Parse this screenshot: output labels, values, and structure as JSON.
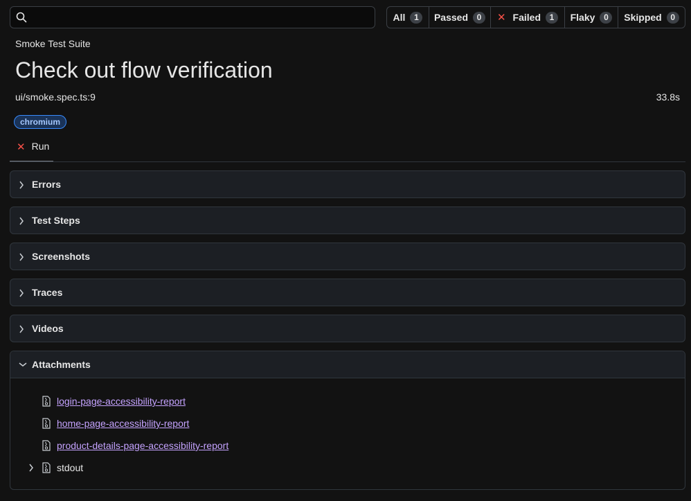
{
  "search": {
    "value": "",
    "placeholder": ""
  },
  "filters": [
    {
      "label": "All",
      "count": "1"
    },
    {
      "label": "Passed",
      "count": "0"
    },
    {
      "label": "Failed",
      "count": "1"
    },
    {
      "label": "Flaky",
      "count": "0"
    },
    {
      "label": "Skipped",
      "count": "0"
    }
  ],
  "test": {
    "suite": "Smoke Test Suite",
    "title": "Check out flow verification",
    "location": "ui/smoke.spec.ts:9",
    "duration": "33.8s",
    "tag": "chromium"
  },
  "run_tab": {
    "label": "Run",
    "status_icon": "x-icon"
  },
  "sections": [
    {
      "label": "Errors",
      "expanded": false
    },
    {
      "label": "Test Steps",
      "expanded": false
    },
    {
      "label": "Screenshots",
      "expanded": false
    },
    {
      "label": "Traces",
      "expanded": false
    },
    {
      "label": "Videos",
      "expanded": false
    }
  ],
  "attachments": {
    "label": "Attachments",
    "expanded": true,
    "items": [
      {
        "name": "login-page-accessibility-report",
        "link": true
      },
      {
        "name": "home-page-accessibility-report",
        "link": true
      },
      {
        "name": "product-details-page-accessibility-report",
        "link": true
      },
      {
        "name": "stdout",
        "link": false,
        "expandable": true
      }
    ]
  },
  "colors": {
    "background": "#121212",
    "panel": "#1c1f24",
    "border": "#30363d",
    "failed": "#f85149",
    "link": "#c5a3ff",
    "tag_border": "#388bfd",
    "tag_bg": "#1a3358"
  }
}
